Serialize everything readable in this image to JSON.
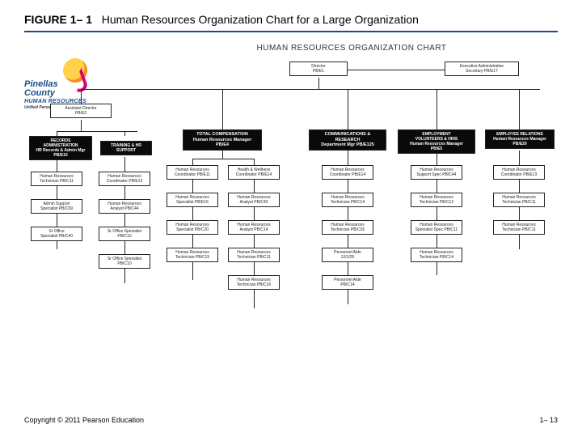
{
  "figureLabel": "FIGURE 1– 1",
  "figureTitle": "Human Resources Organization Chart for a Large Organization",
  "logo": {
    "line1": "Pinellas",
    "line2": "County",
    "dept": "HUMAN RESOURCES",
    "sub": "Unified Personnel System"
  },
  "chartTitle": "HUMAN RESOURCES ORGANIZATION CHART",
  "top": {
    "director": "Director\nPB/E1"
  },
  "rightTop": {
    "execAdmin": "Executive Administrative\nSecretary PB/E17"
  },
  "leftAsst": {
    "asstDir": "Assistant Director\nPB/E2"
  },
  "recAdmin": {
    "header": "RECORDS\nADMINISTRATION\nHR Records & Admin Mgr\nPB/E10",
    "b1": "Human Resources\nTechnician PB/C11",
    "b2": "Admin Support\nSpecialist PB/C09",
    "b3": "Sr Office\nSpecialist PB/C40"
  },
  "training": {
    "header": "TRAINING & HR\nSUPPORT",
    "b1": "Human Resources\nCoordinator PB/E13",
    "b2": "Human Resources\nAnalyst PB/C44",
    "b3": "Sr Office Specialist\nPB/C10",
    "b4": "Sr Office Specialist\nPB/C10"
  },
  "comp": {
    "header": "TOTAL COMPENSATION\nHuman Resources Manager\nPB/E4",
    "col1": {
      "b1": "Human Resources\nCoordinator PB/E11",
      "b2": "Human Resources\nSpecialist PB/E16",
      "b3": "Human Resources\nSpecialist PB/C20",
      "b4": "Human Resources\nTechnician PB/C15"
    },
    "col2": {
      "b1": "Health & Wellness\nCoordinator PB/E14",
      "b2": "Human Resources\nAnalyst PB/C42",
      "b3": "Human Resources\nAnalyst PB/C14",
      "b4": "Human Resources\nTechnician PB/C11",
      "b5": "Human Resources\nTechnician PB/C16"
    }
  },
  "comms": {
    "header": "COMMUNICATIONS &\nRESEARCH\nDepartment Mgr PB/E125",
    "b1": "Human Resources\nCoordinator PB/E14",
    "b2": "Human Resources\nTechnician PB/C14",
    "b3": "Human Resources\nTechnician PB/C26",
    "b4": "Personnel Aide\n12/1/25",
    "b5": "Personnel Aide\nPB/C14"
  },
  "emp": {
    "header": "EMPLOYMENT\nVOLUNTEERS & HRIS\nHuman Resources Manager\nPB/E5",
    "b1": "Human Resources\nSupport Spec PB/C44",
    "b2": "Human Resources\nTechnician PB/C12",
    "b3": "Human Resources\nSpecialist Spec PB/C11",
    "b4": "Human Resources\nTechnician PB/C14"
  },
  "emprel": {
    "header": "EMPLOYEE RELATIONS\nHuman Resources Manager\nPB/E29",
    "b1": "Human Resources\nCoordinator PB/E13",
    "b2": "Human Resources\nTechnician PB/C11",
    "b3": "Human Resources\nTechnician PB/C11"
  },
  "copyright": "Copyright © 2011 Pearson Education",
  "pageNum": "1– 13"
}
